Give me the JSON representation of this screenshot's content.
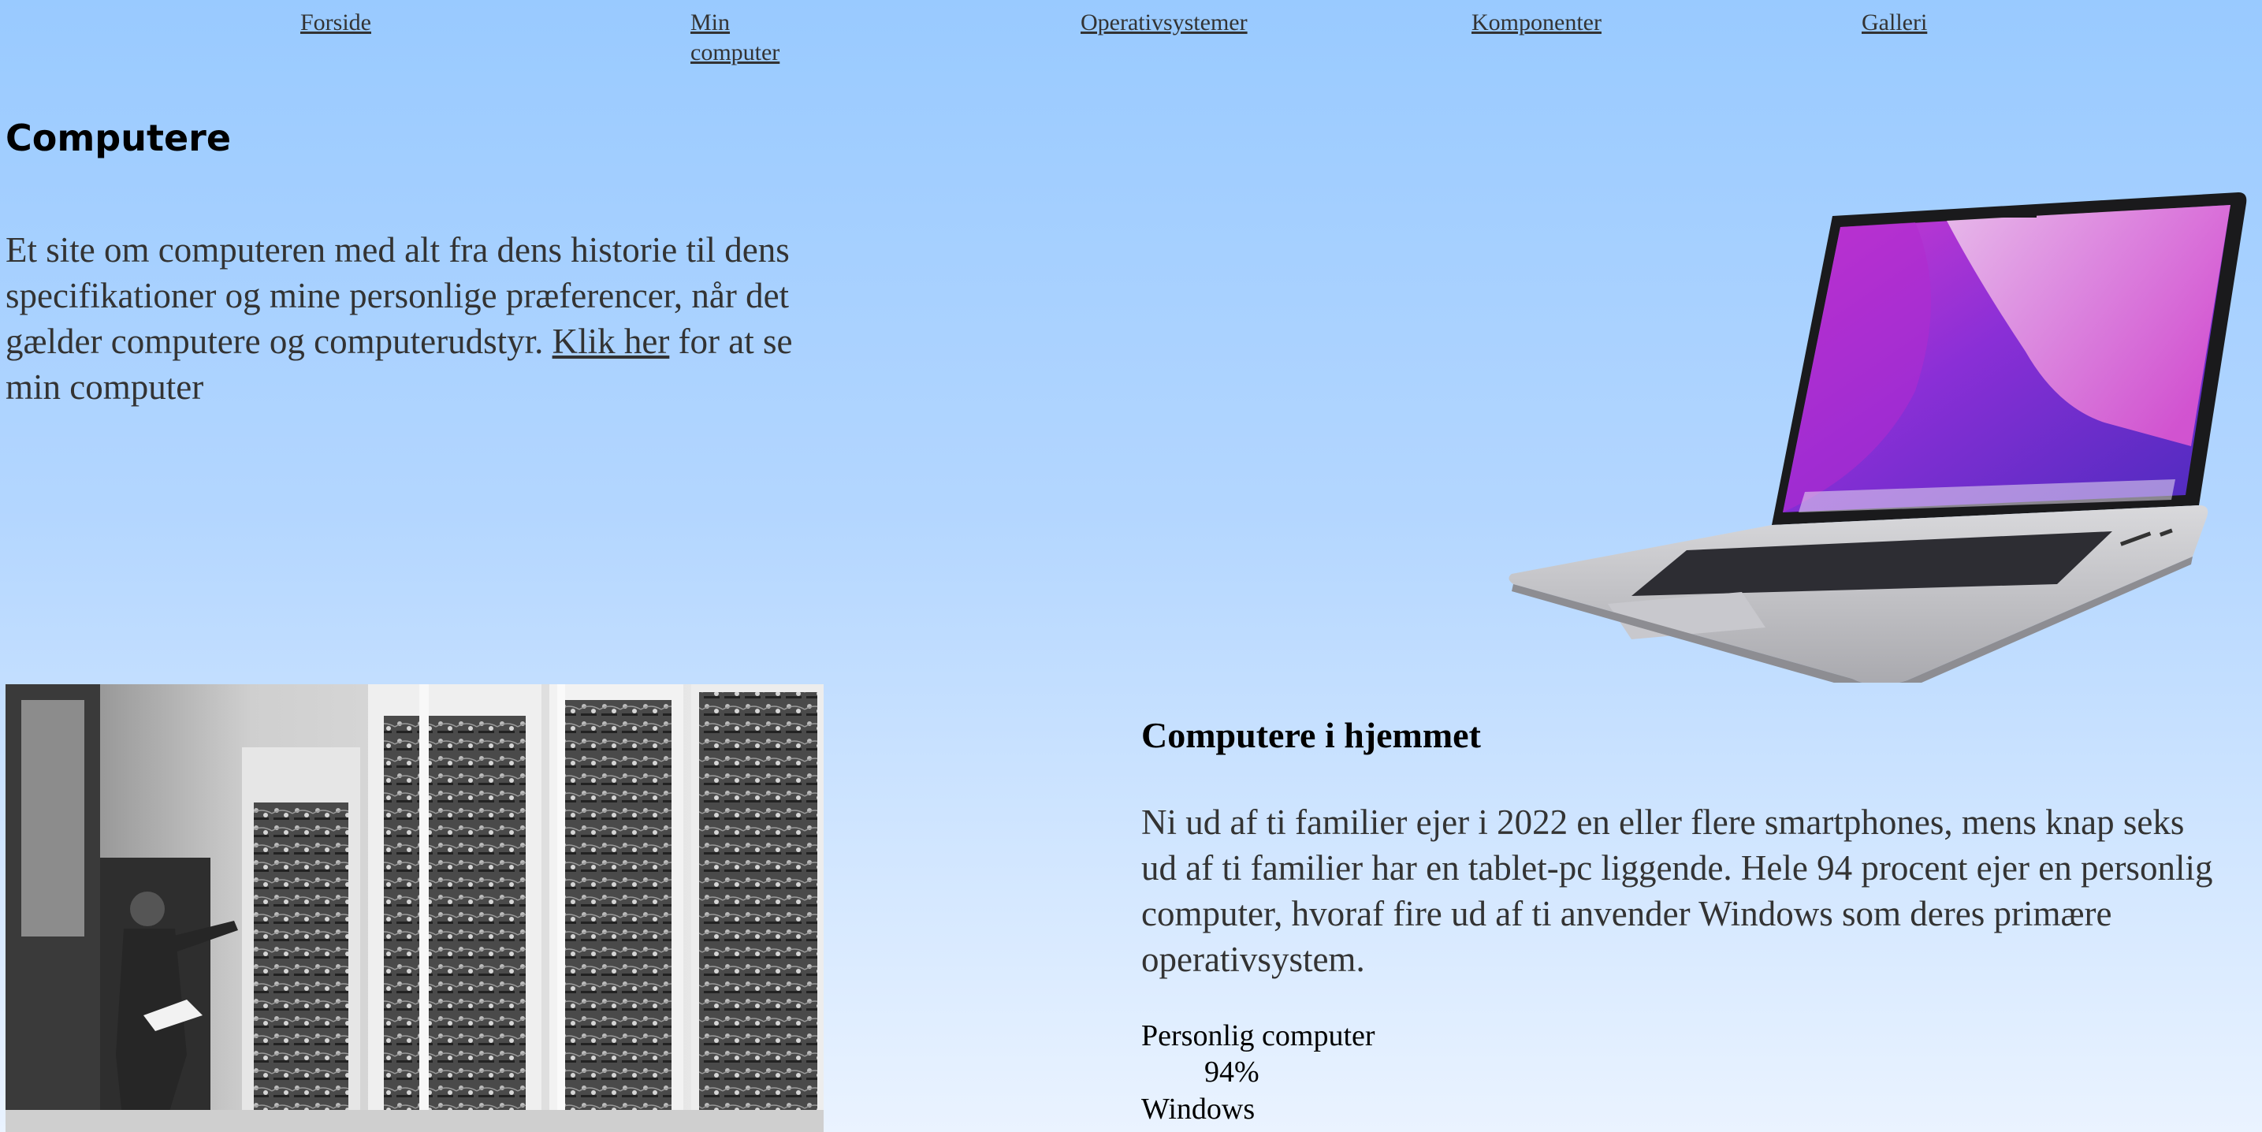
{
  "nav": {
    "items": [
      {
        "label": "Forside"
      },
      {
        "label": "Min computer"
      },
      {
        "label": "Operativsystemer"
      },
      {
        "label": "Komponenter"
      },
      {
        "label": "Galleri"
      }
    ]
  },
  "hero": {
    "title": "Computere",
    "intro_text": "Et site om computeren med alt fra dens historie til dens specifikationer og mine personlige præferencer, når det gælder computere og computerudstyr.",
    "intro_link": "Klik her",
    "intro_suffix": "for at se min computer"
  },
  "home": {
    "title": "Computere i hjemmet",
    "text": "Ni ud af ti familier ejer i 2022 en eller flere smartphones, mens knap seks ud af ti familier har en tablet-pc liggende. Hele 94 procent ejer en personlig computer, hvoraf fire ud af ti anvender Windows som deres primære operativsystem.",
    "stats": [
      {
        "label": "Personlig computer",
        "value": "94%"
      },
      {
        "label": "Windows"
      }
    ]
  },
  "colors": {
    "background_top": "#99caff",
    "background_bottom": "#eaf3ff",
    "laptop_screen": "#c63bd6"
  }
}
